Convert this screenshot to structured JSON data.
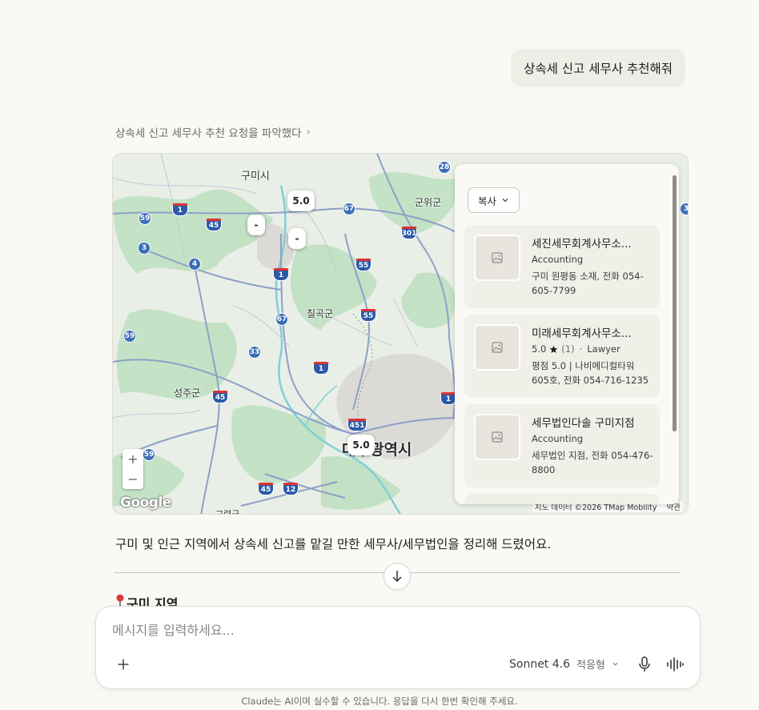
{
  "user_message": "상속세 신고 세무사 추천해줘",
  "thinking": {
    "label": "상속세 신고 세무사 추천 요청을 파악했다",
    "chevron": "›"
  },
  "map": {
    "places": {
      "gumi": "구미시",
      "gunwi": "군위군",
      "chilgok": "칠곡군",
      "seongju": "성주군",
      "daegu": "대구광역시",
      "goryeong": "고령군"
    },
    "routes": [
      "28",
      "59",
      "1",
      "45",
      "67",
      "301",
      "3",
      "4",
      "55",
      "1",
      "59",
      "67",
      "55",
      "33",
      "1",
      "45",
      "451",
      "1",
      "59",
      "45",
      "12",
      "3"
    ],
    "pins": {
      "rating_a": "5.0",
      "dash_a": "-",
      "dash_b": "-",
      "rating_b": "5.0"
    },
    "zoom_in": "+",
    "zoom_out": "−",
    "logo": "Google",
    "attribution": "지도 데이터 ©2026 TMap Mobility",
    "terms": "약관"
  },
  "results_panel": {
    "copy_label": "복사",
    "items": [
      {
        "title": "세진세무회계사무소...",
        "category": "Accounting",
        "desc": "구미 원평동 소재, 전화 054-605-7799"
      },
      {
        "title": "미래세무회계사무소...",
        "rating": "5.0",
        "reviews": "(1)",
        "separator": "·",
        "category": "Lawyer",
        "desc": "평점 5.0 | 나비메디컬타워 605호, 전화 054-716-1235"
      },
      {
        "title": "세무법인다솔 구미지점",
        "category": "Accounting",
        "desc": "세무법인 지점, 전화 054-476-8800"
      }
    ]
  },
  "response_text": "구미 및 인근 지역에서 상속세 신고를 맡길 만한 세무사/세무법인을 정리해 드렸어요.",
  "section_heading": "구미 지역",
  "composer": {
    "placeholder": "메시지를 입력하세요...",
    "model": "Sonnet 4.6",
    "mode": "적응형"
  },
  "disclaimer": "Claude는 AI이며 실수할 수 있습니다. 응답을 다시 한번 확인해 주세요.",
  "colors": {
    "page_bg": "#faf9f5",
    "map_land": "#e8efe4",
    "map_forest": "#bfe0c2",
    "map_road": "#8ea0c8",
    "map_river": "#7fd0d8",
    "pin_red": "#c8302f"
  }
}
